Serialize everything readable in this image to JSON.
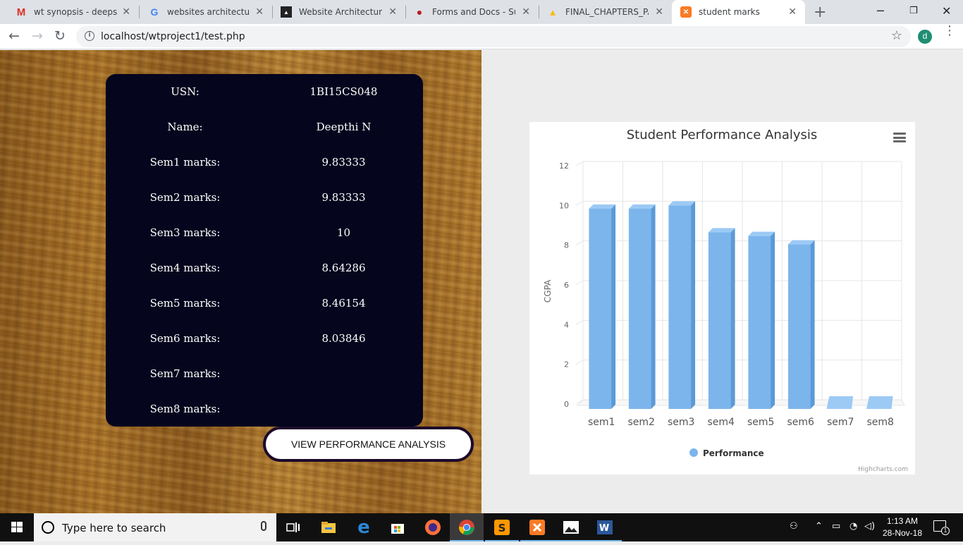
{
  "browser": {
    "tabs": [
      {
        "title": "wt synopsis - deeps.nag",
        "icon": "gmail-icon"
      },
      {
        "title": "websites architecture - G",
        "icon": "google-icon"
      },
      {
        "title": "Website Architecture &",
        "icon": "site-icon"
      },
      {
        "title": "Forms and Docs - Suma",
        "icon": "forms-icon"
      },
      {
        "title": "FINAL_CHAPTERS_PAGE",
        "icon": "drive-icon"
      },
      {
        "title": "student marks",
        "icon": "xampp-icon"
      }
    ],
    "url": "localhost/wtproject1/test.php",
    "profile_initial": "d"
  },
  "student": {
    "rows": [
      {
        "label": "USN:",
        "value": "1BI15CS048"
      },
      {
        "label": "Name:",
        "value": "Deepthi N"
      },
      {
        "label": "Sem1 marks:",
        "value": "9.83333"
      },
      {
        "label": "Sem2 marks:",
        "value": "9.83333"
      },
      {
        "label": "Sem3 marks:",
        "value": "10"
      },
      {
        "label": "Sem4 marks:",
        "value": "8.64286"
      },
      {
        "label": "Sem5 marks:",
        "value": "8.46154"
      },
      {
        "label": "Sem6 marks:",
        "value": "8.03846"
      },
      {
        "label": "Sem7 marks:",
        "value": ""
      },
      {
        "label": "Sem8 marks:",
        "value": ""
      }
    ],
    "button_label": "VIEW PERFORMANCE ANALYSIS"
  },
  "chart_data": {
    "type": "bar",
    "title": "Student Performance Analysis",
    "categories": [
      "sem1",
      "sem2",
      "sem3",
      "sem4",
      "sem5",
      "sem6",
      "sem7",
      "sem8"
    ],
    "series": [
      {
        "name": "Performance",
        "values": [
          9.83333,
          9.83333,
          10,
          8.64286,
          8.46154,
          8.03846,
          0,
          0
        ]
      }
    ],
    "ylabel": "CGPA",
    "xlabel": "",
    "ylim": [
      0,
      12
    ],
    "yticks": [
      "0",
      "2",
      "4",
      "6",
      "8",
      "10",
      "12"
    ],
    "grid": true,
    "legend": "bottom-center",
    "credits": "Highcharts.com",
    "colors": {
      "bar": "#7cb5ec",
      "bar_side": "#5a9ad8",
      "bar_top": "#9ccaf5"
    }
  },
  "taskbar": {
    "search_placeholder": "Type here to search",
    "time": "1:13 AM",
    "date": "28-Nov-18",
    "notification_count": "1"
  }
}
